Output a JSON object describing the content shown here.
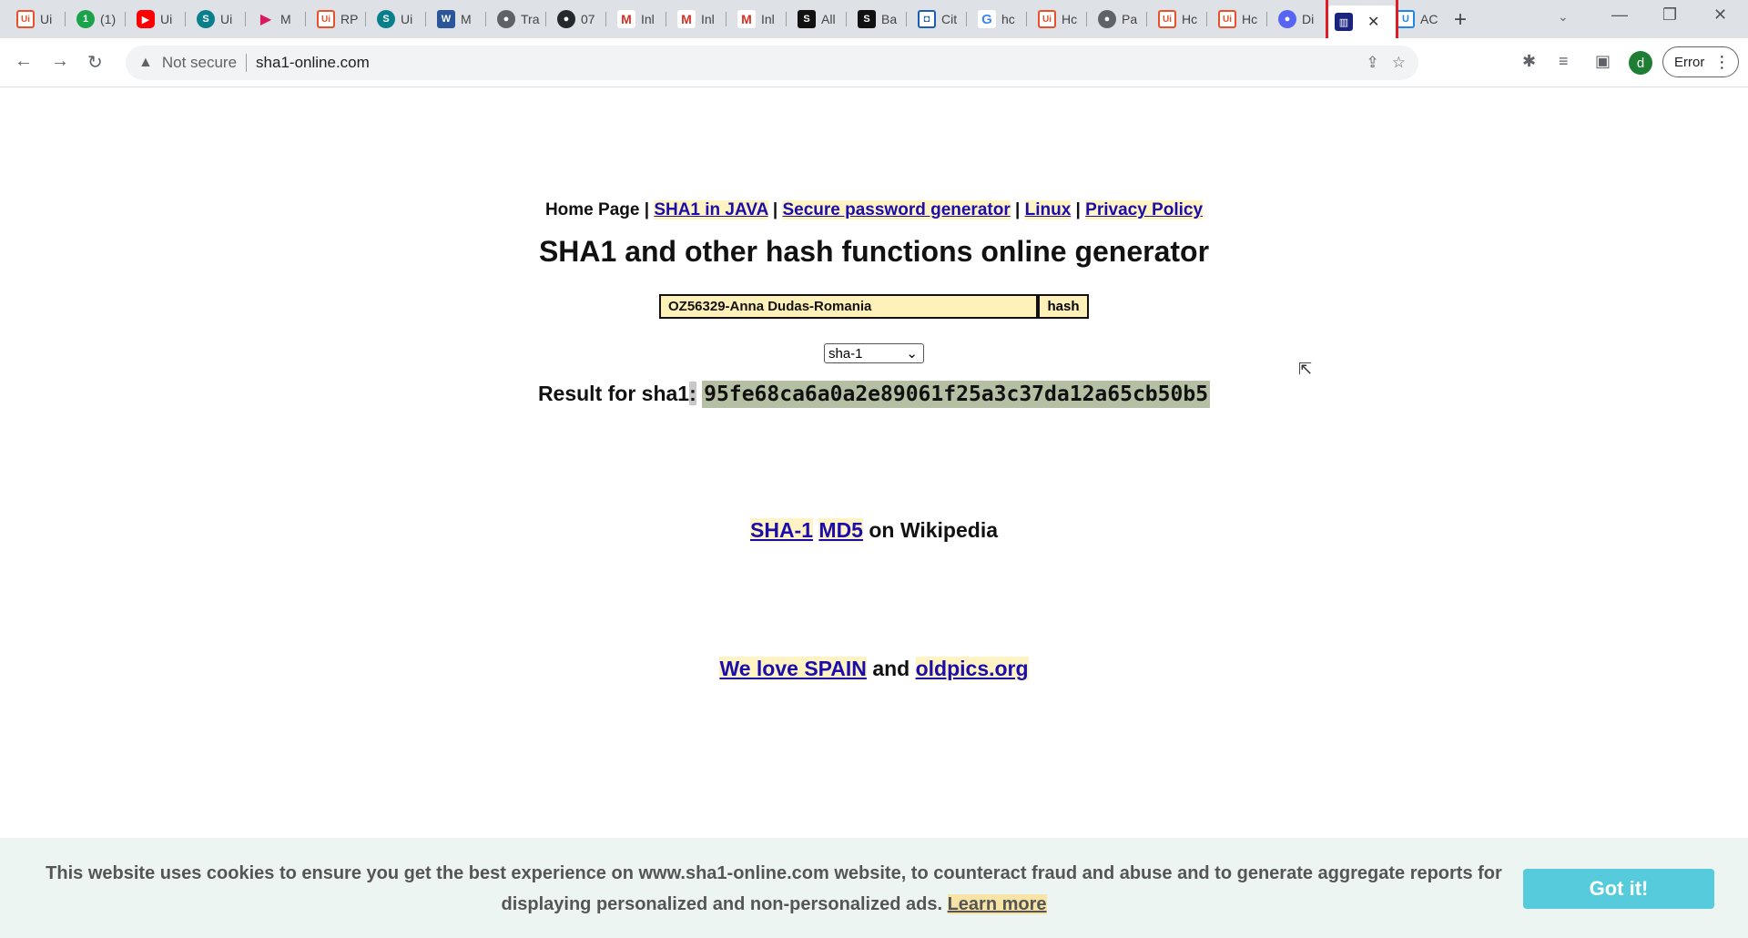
{
  "tabs": [
    {
      "icon": "uipath-icon",
      "label": "Ui"
    },
    {
      "icon": "green-badge-icon",
      "label": "(1)"
    },
    {
      "icon": "youtube-icon",
      "label": "Ui"
    },
    {
      "icon": "sharepoint-icon",
      "label": "Ui"
    },
    {
      "icon": "play-icon",
      "label": "M"
    },
    {
      "icon": "uipath-icon",
      "label": "RP"
    },
    {
      "icon": "sharepoint-icon",
      "label": "Ui"
    },
    {
      "icon": "word-icon",
      "label": "M"
    },
    {
      "icon": "globe-icon",
      "label": "Tra"
    },
    {
      "icon": "github-icon",
      "label": "07"
    },
    {
      "icon": "gmail-icon",
      "label": "Inl"
    },
    {
      "icon": "gmail-icon",
      "label": "Inl"
    },
    {
      "icon": "gmail-icon",
      "label": "Inl"
    },
    {
      "icon": "s-icon",
      "label": "All"
    },
    {
      "icon": "s-icon",
      "label": "Ba"
    },
    {
      "icon": "bag-icon",
      "label": "Cit"
    },
    {
      "icon": "google-icon",
      "label": "hc"
    },
    {
      "icon": "uipath-icon",
      "label": "Hc"
    },
    {
      "icon": "globe-icon",
      "label": "Pa"
    },
    {
      "icon": "uipath-icon",
      "label": "Hc"
    },
    {
      "icon": "uipath-icon",
      "label": "Hc"
    },
    {
      "icon": "discord-icon",
      "label": "Di"
    },
    {
      "icon": "hash-icon",
      "label": "",
      "active": true
    },
    {
      "icon": "ac-icon",
      "label": "AC"
    }
  ],
  "toolbar": {
    "security": "Not secure",
    "url": "sha1-online.com",
    "avatar": "d",
    "error_label": "Error"
  },
  "page": {
    "home": "Home Page",
    "links": [
      "SHA1 in JAVA",
      "Secure password generator",
      "Linux",
      "Privacy Policy"
    ],
    "title": "SHA1 and other hash functions online generator",
    "input_value": "OZ56329-Anna Dudas-Romania",
    "hash_button": "hash",
    "algorithm": "sha-1",
    "result_label": "Result for sha1",
    "result_colon": ":",
    "result_hash": "95fe68ca6a0a2e89061f25a3c37da12a65cb50b5",
    "wiki_links": [
      "SHA-1",
      "MD5"
    ],
    "wiki_suffix": "on Wikipedia",
    "love_link": "We love SPAIN",
    "love_and": "and",
    "oldpics_link": "oldpics.org"
  },
  "cookie": {
    "text": "This website uses cookies to ensure you get the best experience on www.sha1-online.com website, to counteract fraud and abuse and to generate aggregate reports for displaying personalized and non-personalized ads.",
    "learn_more": "Learn more",
    "button": "Got it!"
  },
  "colors": {
    "accent_link": "#1a0dab",
    "link_highlight": "#fff3c4",
    "input_bg": "#fff1b8",
    "result_highlight": "#b5bfa3",
    "cookie_button": "#56cbdb",
    "active_tab_outline": "#e01b24"
  }
}
